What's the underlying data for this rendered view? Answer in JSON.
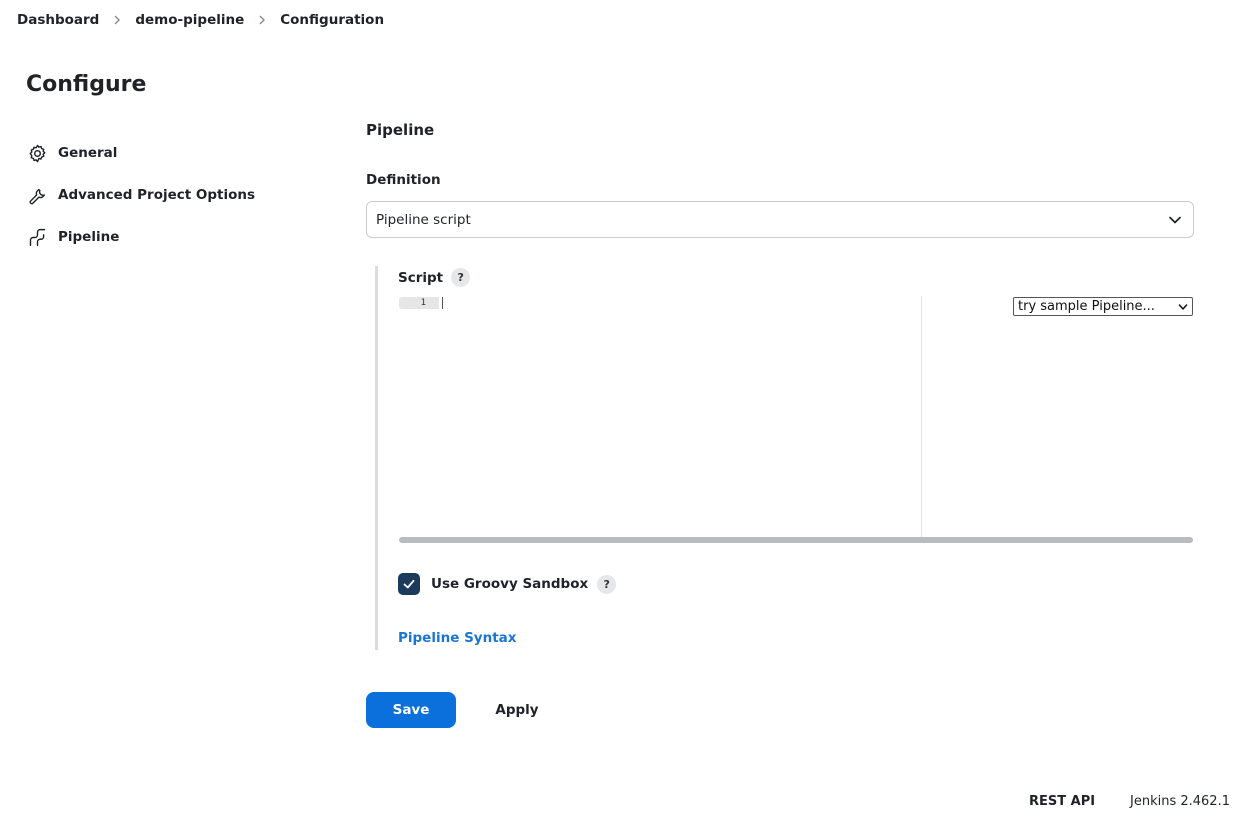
{
  "breadcrumb": {
    "items": [
      "Dashboard",
      "demo-pipeline",
      "Configuration"
    ]
  },
  "page": {
    "title": "Configure"
  },
  "sidebar": {
    "items": [
      {
        "label": "General",
        "icon": "gear-icon"
      },
      {
        "label": "Advanced Project Options",
        "icon": "wrench-icon"
      },
      {
        "label": "Pipeline",
        "icon": "pipeline-icon"
      }
    ]
  },
  "pipeline": {
    "section_title": "Pipeline",
    "definition_label": "Definition",
    "definition_value": "Pipeline script",
    "script_label": "Script",
    "help_glyph": "?",
    "editor": {
      "line_number": "1",
      "sample_select": "try sample Pipeline..."
    },
    "sandbox": {
      "label": "Use Groovy Sandbox",
      "checked": true
    },
    "syntax_link": "Pipeline Syntax"
  },
  "actions": {
    "save_label": "Save",
    "apply_label": "Apply"
  },
  "footer": {
    "rest_api": "REST API",
    "version": "Jenkins 2.462.1"
  },
  "colors": {
    "primary": "#0b6fdc",
    "link": "#1976d2",
    "checkbox": "#1b3a5c"
  }
}
